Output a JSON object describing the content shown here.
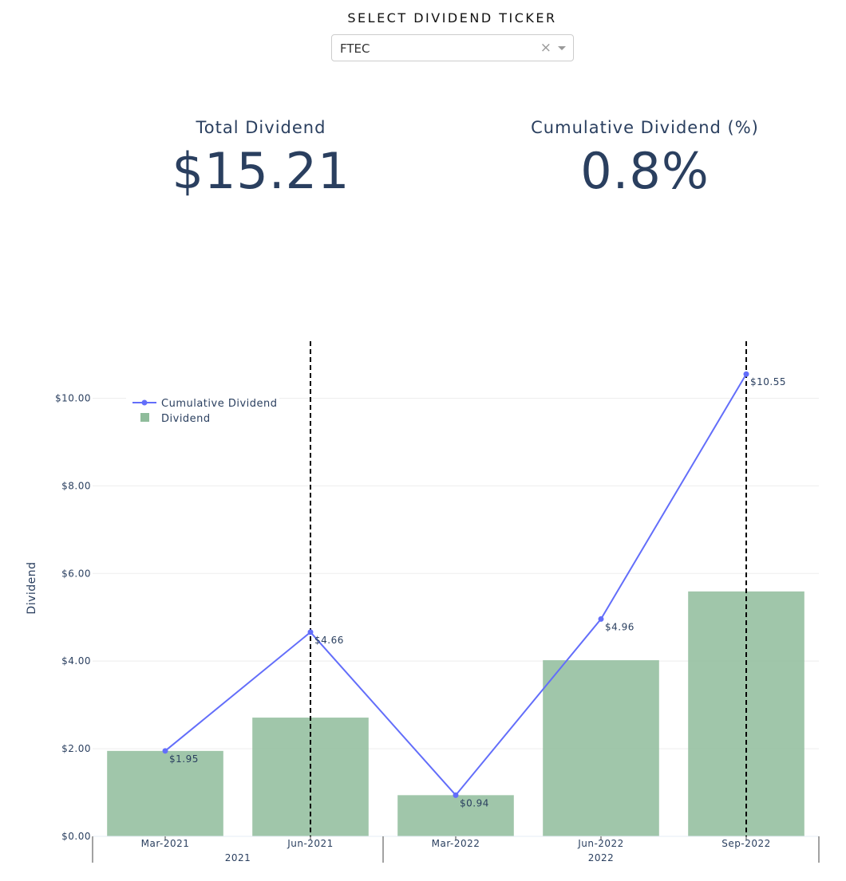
{
  "selector": {
    "label": "SELECT DIVIDEND TICKER",
    "value": "FTEC",
    "clear_icon": "×"
  },
  "kpis": {
    "total": {
      "title": "Total Dividend",
      "value": "$15.21"
    },
    "cumulative": {
      "title": "Cumulative Dividend (%)",
      "value": "0.8%"
    }
  },
  "chart_data": {
    "type": "bar",
    "categories": [
      "Mar-2021",
      "Jun-2021",
      "Mar-2022",
      "Jun-2022",
      "Sep-2022"
    ],
    "year_groups": [
      {
        "label": "2021",
        "categories": [
          "Mar-2021",
          "Jun-2021"
        ]
      },
      {
        "label": "2022",
        "categories": [
          "Mar-2022",
          "Jun-2022",
          "Sep-2022"
        ]
      }
    ],
    "ylabel": "Dividend",
    "ylim": [
      0,
      11.3
    ],
    "yticks": [
      0,
      2,
      4,
      6,
      8,
      10
    ],
    "ytick_labels": [
      "$0.00",
      "$2.00",
      "$4.00",
      "$6.00",
      "$8.00",
      "$10.00"
    ],
    "grid": true,
    "legend_position": "top-left",
    "series": [
      {
        "name": "Dividend",
        "type": "bar",
        "color": "#8fbc9b",
        "values": [
          1.95,
          2.71,
          0.94,
          4.02,
          5.59
        ]
      },
      {
        "name": "Cumulative Dividend",
        "type": "line",
        "color": "#636efa",
        "values": [
          1.95,
          4.66,
          0.94,
          4.96,
          10.55
        ],
        "labels": [
          "$1.95",
          "$4.66",
          "$0.94",
          "$4.96",
          "$10.55"
        ]
      }
    ],
    "vertical_markers": [
      "Jun-2021",
      "Sep-2022"
    ]
  }
}
